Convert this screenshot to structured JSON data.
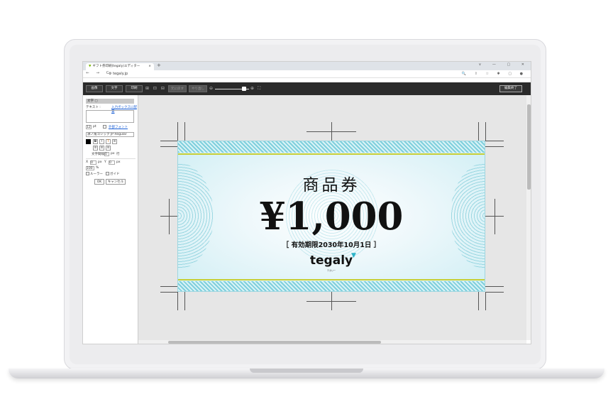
{
  "browser": {
    "tab_title": "ギフト券印刷(tegaly)エディター",
    "tab_close": "×",
    "new_tab": "+",
    "window_controls": "∨ — ▢ ✕",
    "nav": "← → C",
    "url": "tegaly.jp",
    "bar_icons": "🔍 ⇪ ☆ ✱ ▢ ●"
  },
  "toolbar": {
    "btn_image": "画像",
    "btn_text": "文字",
    "btn_print": "印刷",
    "icons": "⊞ ⊡ ⊟ ⊠",
    "undo": "元に戻す",
    "redo": "やり直し",
    "zoom_out": "⊖",
    "zoom_in": "⊕",
    "fit": "⛶",
    "done": "編集終了"
  },
  "panel": {
    "title": "文字  ▢",
    "text_label": "テキスト :",
    "preset_link": "入力ボックスに配置",
    "size_value": "12",
    "size_unit": "pt",
    "font_link": "外部フォント",
    "font_select": "源ノ角ゴシック JP Regular",
    "spacing_label": "文字間隔",
    "spacing_value": "0",
    "spacing_unit": "px",
    "line_label": "行",
    "x_label": "X",
    "x_value": "0",
    "x_unit": "px",
    "y_label": "Y",
    "y_value": "0",
    "y_unit": "px",
    "w_value": "100",
    "w_unit": "%",
    "check_a": "ルーラー",
    "check_b": "ガイド",
    "ok": "OK",
    "cancel": "キャンセル"
  },
  "ticket": {
    "title": "商品券",
    "amount": "¥1,000",
    "expiry": "［ 有効期限2030年10月1日 ］",
    "logo": "tegaly",
    "logo_sub": "テガリー"
  }
}
